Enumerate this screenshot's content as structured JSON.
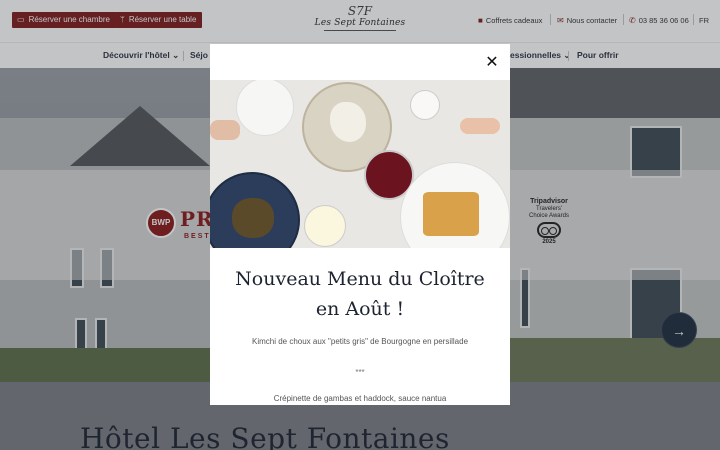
{
  "topbar": {
    "book_room": "Réserver une chambre",
    "book_table": "Réserver une table",
    "logo_monogram": "S7F",
    "logo_name": "Les Sept Fontaines",
    "gift_boxes": "Coffrets cadeaux",
    "contact": "Nous contacter",
    "phone": "03 85 36 06 06",
    "language": "FR"
  },
  "nav": {
    "items": [
      {
        "label": "Découvrir l'hôtel ⌄"
      },
      {
        "label": "Séjo"
      },
      {
        "label": "essionnelles ⌄"
      },
      {
        "label": "Pour offrir"
      }
    ]
  },
  "hero": {
    "badge_bwp": "BWP",
    "brand_text": "PRE",
    "brand_sub": "BEST W",
    "award_title": "Tripadvisor",
    "award_line1": "Travelers'",
    "award_line2": "Choice Awards",
    "award_year": "2025",
    "next_arrow": "→"
  },
  "page": {
    "title": "Hôtel Les Sept Fontaines"
  },
  "modal": {
    "close": "✕",
    "title": "Nouveau Menu du Cloître en Août !",
    "text1": "Kimchi de choux aux \"petits gris\" de Bourgogne en persillade",
    "dots": "***",
    "text2": "Crépinette de gambas et haddock, sauce nantua"
  },
  "colors": {
    "accent": "#7f1d1d",
    "navy": "#1d2330"
  }
}
